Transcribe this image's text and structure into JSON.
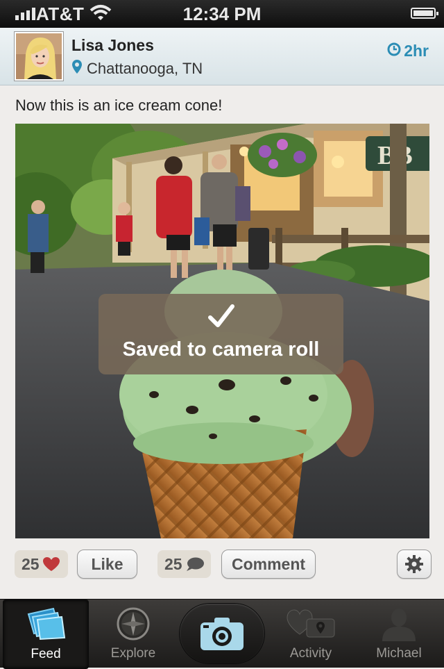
{
  "status_bar": {
    "carrier": "AT&T",
    "time": "12:34 PM"
  },
  "post": {
    "username": "Lisa Jones",
    "location": "Chattanooga, TN",
    "time_ago": "2hr",
    "caption": "Now this is an ice cream cone!",
    "photo_sign_text": "BB"
  },
  "toast": {
    "message": "Saved to camera roll",
    "icon": "checkmark-icon"
  },
  "actions": {
    "likes_count": "25",
    "like_label": "Like",
    "comments_count": "25",
    "comment_label": "Comment"
  },
  "tab_bar": {
    "tabs": [
      {
        "label": "Feed",
        "icon": "feed-icon",
        "active": true
      },
      {
        "label": "Explore",
        "icon": "compass-icon",
        "active": false
      },
      {
        "label": "",
        "icon": "camera-icon",
        "active": false
      },
      {
        "label": "Activity",
        "icon": "activity-icon",
        "active": false
      },
      {
        "label": "Michael",
        "icon": "profile-icon",
        "active": false
      }
    ]
  },
  "colors": {
    "accent": "#2c8db5",
    "heart": "#c0393b",
    "toast_bg": "#786958"
  }
}
